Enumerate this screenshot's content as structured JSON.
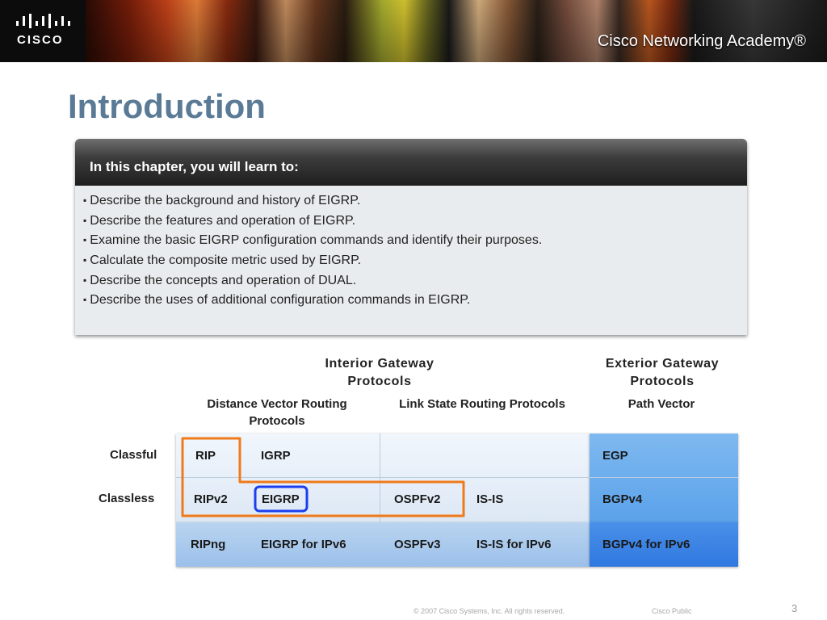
{
  "banner": {
    "logo_text": "CISCO",
    "academy_text": "Cisco Networking Academy®"
  },
  "page_title": "Introduction",
  "objectives": {
    "heading": "In this chapter, you will learn to:",
    "items": [
      "Describe the background and history of EIGRP.",
      "Describe the features and operation of EIGRP.",
      "Examine the basic EIGRP configuration commands and identify their purposes.",
      "Calculate the composite metric used by EIGRP.",
      "Describe the concepts and operation of DUAL.",
      "Describe the uses of additional configuration commands in EIGRP."
    ]
  },
  "diagram": {
    "interior_header": [
      "Interior Gateway",
      "Protocols"
    ],
    "exterior_header": [
      "Exterior Gateway",
      "Protocols"
    ],
    "dv_header": [
      "Distance Vector Routing",
      "Protocols"
    ],
    "ls_header": "Link State Routing Protocols",
    "pv_header": "Path Vector",
    "row_labels": {
      "classful": "Classful",
      "classless": "Classless"
    },
    "rows": {
      "classful": {
        "c1": "RIP",
        "c2": "IGRP",
        "c5": "EGP"
      },
      "classless": {
        "c1": "RIPv2",
        "c2": "EIGRP",
        "c3": "OSPFv2",
        "c4": "IS-IS",
        "c5": "BGPv4"
      },
      "ipv6": {
        "c1": "RIPng",
        "c2": "EIGRP for IPv6",
        "c3": "OSPFv3",
        "c4": "IS-IS for IPv6",
        "c5": "BGPv4 for IPv6"
      }
    },
    "highlight_colors": {
      "orange": "#f07a1a",
      "blue": "#1a3ef0"
    }
  },
  "footer": {
    "copyright": "© 2007 Cisco Systems, Inc. All rights reserved.",
    "classification": "Cisco Public",
    "slide_number": "3"
  }
}
